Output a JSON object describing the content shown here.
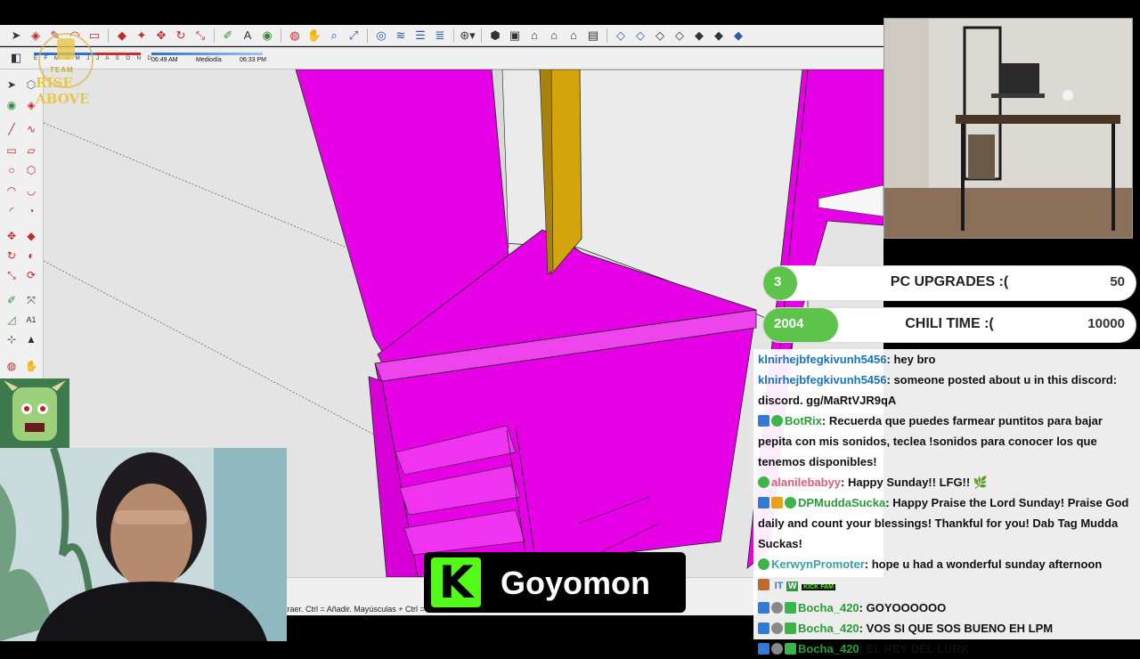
{
  "shadow_settings": {
    "months": "E F M A M J J A S O N D",
    "time_start": "06:49 AM",
    "time_mid": "Mediodía",
    "time_end": "06:33 PM"
  },
  "logo": {
    "line1": "TEAM",
    "line2": "RISE ABOVE"
  },
  "statusbar": {
    "text": "traer. Ctrl = Añadir. Mayúsculas + Ctrl ="
  },
  "goals": [
    {
      "current": "3",
      "title": "PC UPGRADES :(",
      "target": "50",
      "progress": 0.06
    },
    {
      "current": "2004",
      "title": "CHILI TIME :(",
      "target": "10000",
      "progress": 0.2
    }
  ],
  "chat": [
    {
      "user": "klnirhejbfegkivunh5456",
      "color": "#1a74b8",
      "text": "hey bro"
    },
    {
      "user": "klnirhejbfegkivunh5456",
      "color": "#1a74b8",
      "text": "someone posted about u in this discord: discord. gg/MaRtVJR9qA"
    },
    {
      "user": "BotRix",
      "color": "#2a9d3a",
      "text": "Recuerda que puedes farmear puntitos para bajar pepita con mis sonidos, teclea !sonidos para conocer los que tenemos disponibles!"
    },
    {
      "user": "alanilebabyy",
      "color": "#e05a7a",
      "text": "Happy Sunday!! LFG!! 🌿"
    },
    {
      "user": "DPMuddaSucka",
      "color": "#2a9d3a",
      "text": "Happy Praise the Lord Sunday! Praise God daily and count your blessings! Thankful for you! Dab Tag Mudda Suckas!"
    },
    {
      "user": "KerwynPromoter",
      "color": "#3aa0a8",
      "text": "hope u had a wonderful sunday afternoon"
    },
    {
      "user": "Bocha_420",
      "color": "#2a9d3a",
      "text": "GOYOOOOOO"
    },
    {
      "user": "Bocha_420",
      "color": "#2a9d3a",
      "text": "VOS SI QUE SOS BUENO EH LPM"
    },
    {
      "user": "Bocha_420",
      "color": "#2a9d3a",
      "text": "EL REY DEL LURK"
    }
  ],
  "chat_emote_row": {
    "badge1": "IT",
    "badge2": "W",
    "badge3": "KICK FAM"
  },
  "nameplate": {
    "platform_icon": "K",
    "handle": "Goyomon"
  },
  "colors": {
    "model_magenta": "#e600e6",
    "kick_green": "#53fc18",
    "goal_green": "#5ec34a"
  }
}
